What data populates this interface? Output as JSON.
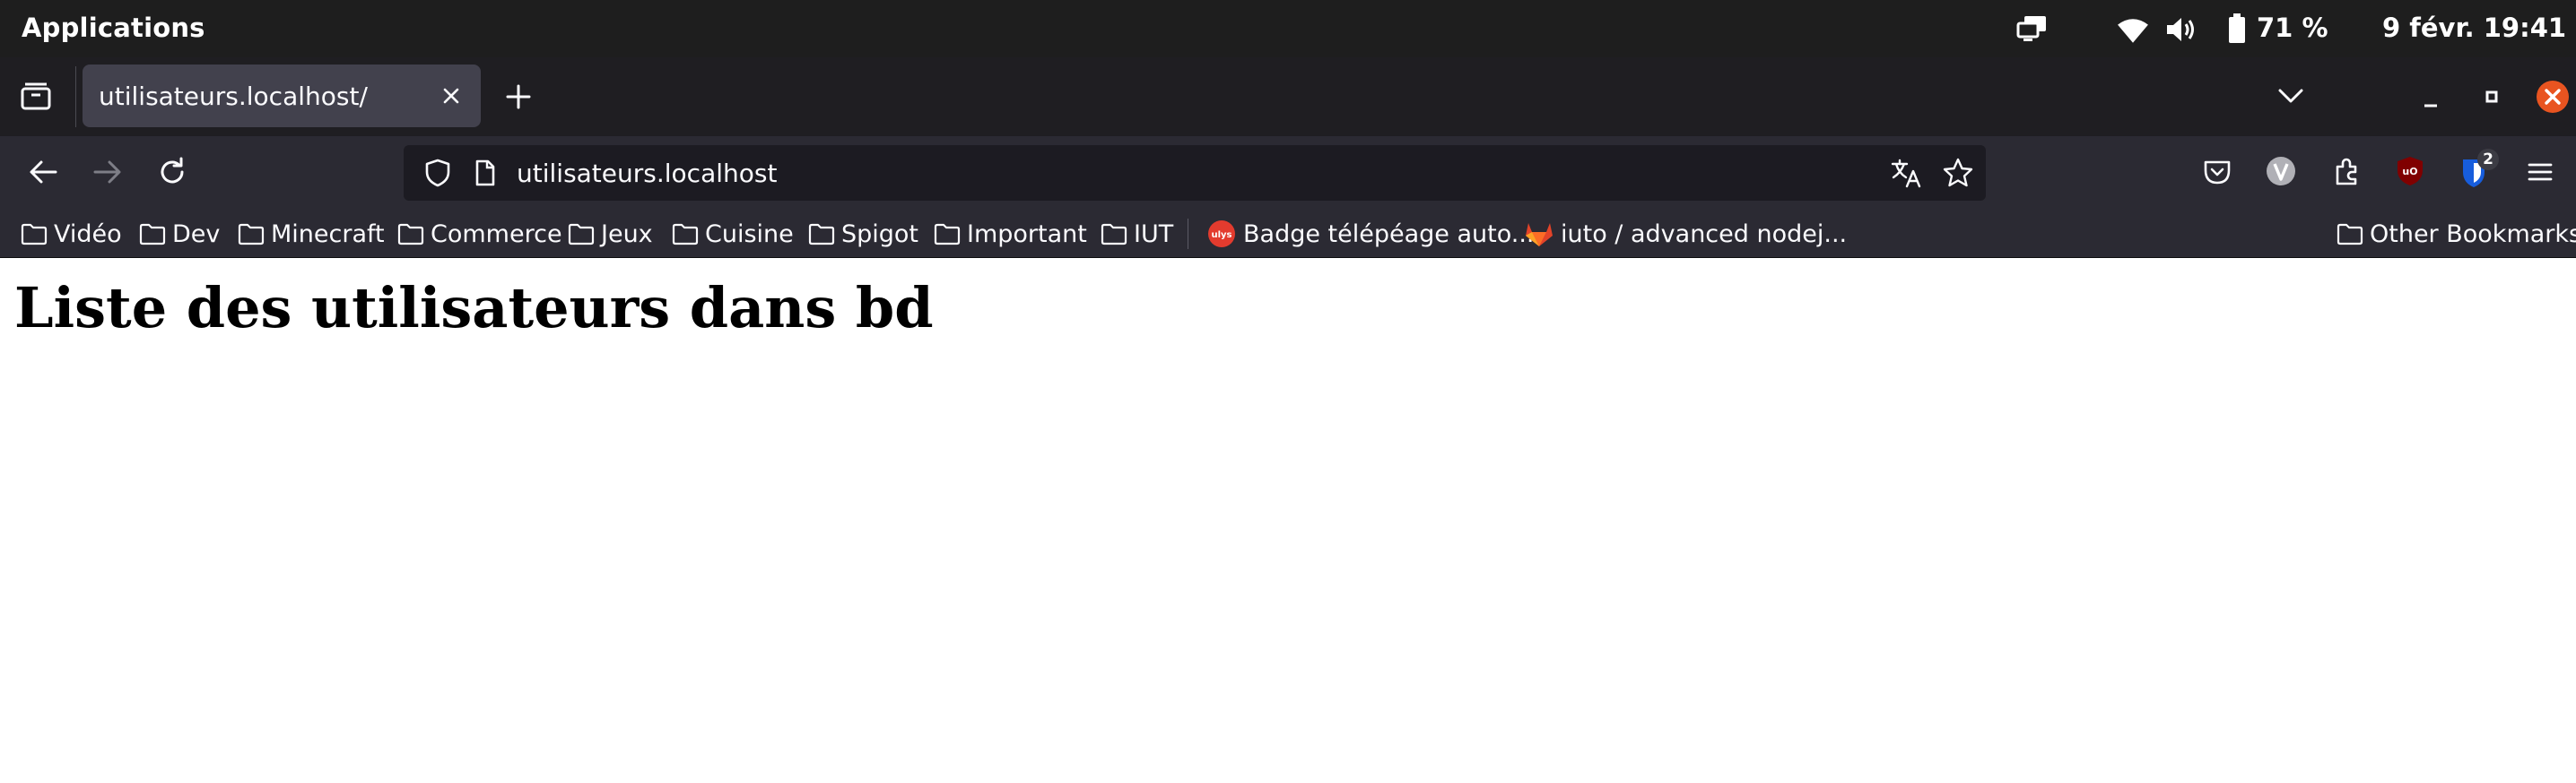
{
  "system_bar": {
    "apps_label": "Applications",
    "battery_label": "71 %",
    "datetime": "9 févr.  19:41"
  },
  "tabs": [
    {
      "title": "utilisateurs.localhost/",
      "active": true
    }
  ],
  "navbar": {
    "url": "utilisateurs.localhost",
    "extension_badge": "2"
  },
  "bookmarks": {
    "folders": [
      "Vidéo",
      "Dev",
      "Minecraft",
      "Commerce",
      "Jeux",
      "Cuisine",
      "Spigot",
      "Important",
      "IUT"
    ],
    "links": [
      "Badge télépéage auto...",
      "iuto / advanced nodej..."
    ],
    "other_bookmarks": "Other Bookmarks"
  },
  "page": {
    "heading": "Liste des utilisateurs dans bd"
  },
  "colors": {
    "system_bar": "#1e1e1e",
    "tab_strip": "#1f1e22",
    "toolbar": "#2b2a33",
    "urlbar": "#1c1b22",
    "window_close": "#e95420",
    "ulys_badge": "#e33b2e",
    "gitlab_logo": "#e24329",
    "ublock": "#800000",
    "bitwarden": "#175ddc"
  },
  "icons": {
    "tab_overview": "tab-overview-icon",
    "new_tab": "plus-icon",
    "list_tabs": "chevron-down-icon",
    "back": "back-arrow-icon",
    "forward": "forward-arrow-icon",
    "reload": "reload-icon",
    "tracking_protection": "shield-icon",
    "page_info": "page-icon",
    "translate": "translate-icon",
    "bookmark_star": "star-icon",
    "pocket": "pocket-icon",
    "menu": "hamburger-icon"
  }
}
